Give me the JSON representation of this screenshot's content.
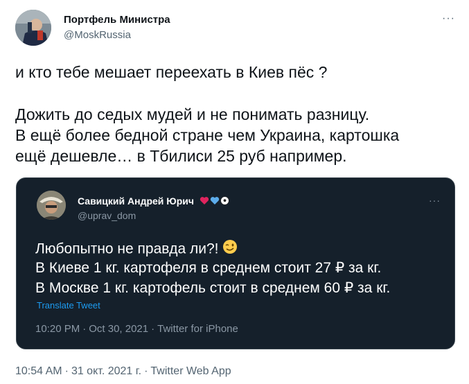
{
  "author": {
    "name": "Портфель Министра",
    "handle": "@MoskRussia"
  },
  "more_label": "···",
  "tweet": {
    "line1": "и кто тебе мешает переехать в Киев пёс ?",
    "line2": "Дожить до седых мудей и не понимать разницу.",
    "line3": "В ещё более бедной стране чем Украина, картошка",
    "line4": "ещё дешевле… в Тбилиси 25 руб например."
  },
  "quote": {
    "name": "Савицкий Андрей Юрич",
    "handle": "@uprav_dom",
    "name_icons": [
      "red-heart-icon",
      "blue-heart-icon",
      "soccer-ball-icon"
    ],
    "line1": "Любопытно не правда ли?!",
    "line1_icon": "winking-face-icon",
    "line2": "В Киеве 1 кг. картофеля в среднем стоит 27 ₽ за кг.",
    "line3": "В Москве 1 кг. картофель стоит в среднем 60 ₽ за кг.",
    "translate": "Translate Tweet",
    "time": "10:20 PM",
    "date": "Oct 30, 2021",
    "source": "Twitter for iPhone"
  },
  "meta": {
    "time": "10:54 AM",
    "date": "31 окт. 2021 г.",
    "source": "Twitter Web App"
  },
  "colors": {
    "quote_bg": "#15202b",
    "link": "#1d9bf0",
    "secondary_text": "#536471"
  }
}
